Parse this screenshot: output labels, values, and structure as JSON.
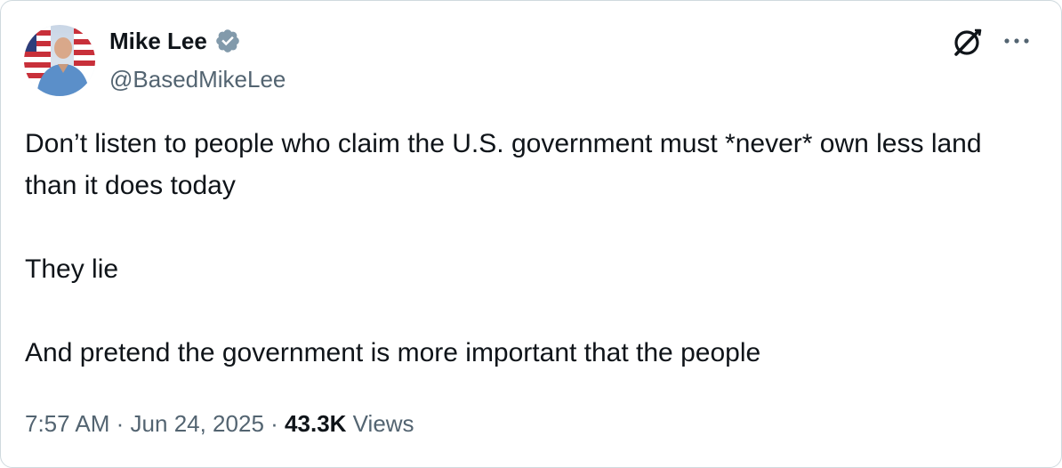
{
  "author": {
    "display_name": "Mike Lee",
    "handle": "@BasedMikeLee",
    "verified_color": "#829aab"
  },
  "tweet": {
    "paragraphs": [
      "Don’t listen to people who claim the U.S. government must *never* own less land than it does today",
      "They lie",
      "And pretend the government is more important that the people"
    ]
  },
  "meta": {
    "time": "7:57 AM",
    "separator": "·",
    "date": "Jun 24, 2025",
    "views_count": "43.3K",
    "views_label": "Views"
  },
  "icons": {
    "verified": "verified-badge-icon",
    "grok": "grok-icon",
    "more": "more-horizontal-icon"
  },
  "colors": {
    "text_primary": "#0f1419",
    "text_secondary": "#536471",
    "border": "#cfd9de"
  }
}
